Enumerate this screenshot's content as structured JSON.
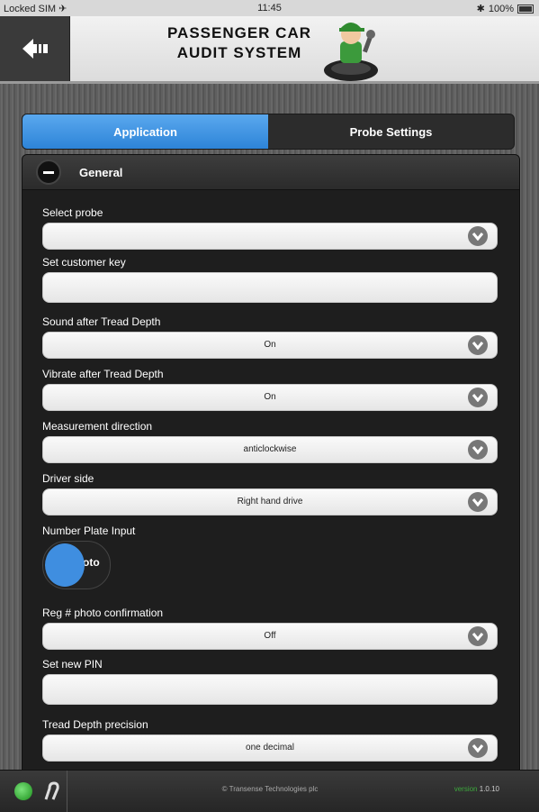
{
  "status_bar": {
    "carrier": "Locked SIM ✈",
    "time": "11:45",
    "battery": "100%"
  },
  "header": {
    "title_line1": "PASSENGER CAR",
    "title_line2": "AUDIT SYSTEM"
  },
  "tabs": [
    {
      "label": "Application",
      "active": true
    },
    {
      "label": "Probe Settings",
      "active": false
    }
  ],
  "section": {
    "title": "General",
    "fields": {
      "select_probe": {
        "label": "Select probe",
        "value": ""
      },
      "customer_key": {
        "label": "Set customer key",
        "value": ""
      },
      "sound": {
        "label": "Sound after Tread Depth",
        "value": "On"
      },
      "vibrate": {
        "label": "Vibrate after Tread Depth",
        "value": "On"
      },
      "direction": {
        "label": "Measurement direction",
        "value": "anticlockwise"
      },
      "driver_side": {
        "label": "Driver side",
        "value": "Right hand drive"
      },
      "number_plate": {
        "label": "Number Plate Input",
        "value": "oto"
      },
      "reg_photo": {
        "label": "Reg # photo confirmation",
        "value": "Off"
      },
      "new_pin": {
        "label": "Set new PIN",
        "value": ""
      },
      "precision": {
        "label": "Tread Depth precision",
        "value": "one decimal"
      }
    }
  },
  "footer": {
    "copyright": "© Transense Technologies plc",
    "version_label": "version",
    "version": "1.0.10"
  },
  "colors": {
    "accent": "#3f8ee0",
    "status_green": "#3da83d"
  }
}
